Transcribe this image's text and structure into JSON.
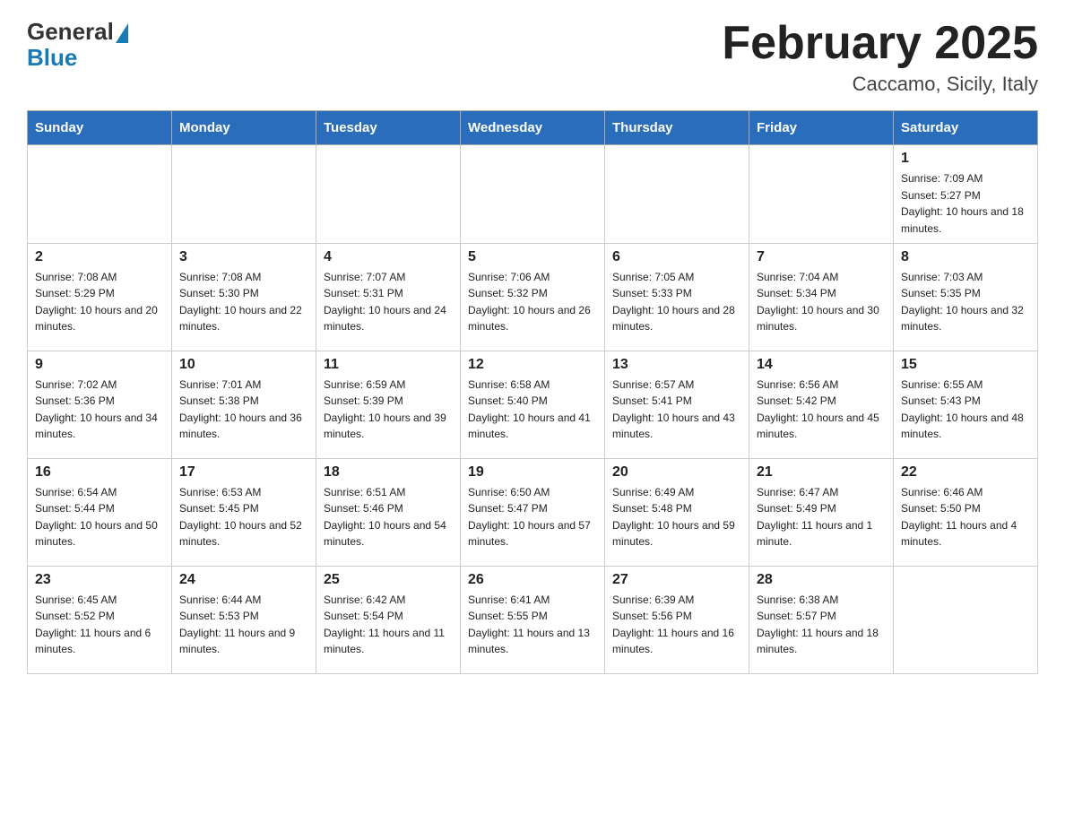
{
  "header": {
    "logo_general": "General",
    "logo_blue": "Blue",
    "month_title": "February 2025",
    "location": "Caccamo, Sicily, Italy"
  },
  "days_of_week": [
    "Sunday",
    "Monday",
    "Tuesday",
    "Wednesday",
    "Thursday",
    "Friday",
    "Saturday"
  ],
  "weeks": [
    [
      {
        "day": "",
        "info": ""
      },
      {
        "day": "",
        "info": ""
      },
      {
        "day": "",
        "info": ""
      },
      {
        "day": "",
        "info": ""
      },
      {
        "day": "",
        "info": ""
      },
      {
        "day": "",
        "info": ""
      },
      {
        "day": "1",
        "info": "Sunrise: 7:09 AM\nSunset: 5:27 PM\nDaylight: 10 hours and 18 minutes."
      }
    ],
    [
      {
        "day": "2",
        "info": "Sunrise: 7:08 AM\nSunset: 5:29 PM\nDaylight: 10 hours and 20 minutes."
      },
      {
        "day": "3",
        "info": "Sunrise: 7:08 AM\nSunset: 5:30 PM\nDaylight: 10 hours and 22 minutes."
      },
      {
        "day": "4",
        "info": "Sunrise: 7:07 AM\nSunset: 5:31 PM\nDaylight: 10 hours and 24 minutes."
      },
      {
        "day": "5",
        "info": "Sunrise: 7:06 AM\nSunset: 5:32 PM\nDaylight: 10 hours and 26 minutes."
      },
      {
        "day": "6",
        "info": "Sunrise: 7:05 AM\nSunset: 5:33 PM\nDaylight: 10 hours and 28 minutes."
      },
      {
        "day": "7",
        "info": "Sunrise: 7:04 AM\nSunset: 5:34 PM\nDaylight: 10 hours and 30 minutes."
      },
      {
        "day": "8",
        "info": "Sunrise: 7:03 AM\nSunset: 5:35 PM\nDaylight: 10 hours and 32 minutes."
      }
    ],
    [
      {
        "day": "9",
        "info": "Sunrise: 7:02 AM\nSunset: 5:36 PM\nDaylight: 10 hours and 34 minutes."
      },
      {
        "day": "10",
        "info": "Sunrise: 7:01 AM\nSunset: 5:38 PM\nDaylight: 10 hours and 36 minutes."
      },
      {
        "day": "11",
        "info": "Sunrise: 6:59 AM\nSunset: 5:39 PM\nDaylight: 10 hours and 39 minutes."
      },
      {
        "day": "12",
        "info": "Sunrise: 6:58 AM\nSunset: 5:40 PM\nDaylight: 10 hours and 41 minutes."
      },
      {
        "day": "13",
        "info": "Sunrise: 6:57 AM\nSunset: 5:41 PM\nDaylight: 10 hours and 43 minutes."
      },
      {
        "day": "14",
        "info": "Sunrise: 6:56 AM\nSunset: 5:42 PM\nDaylight: 10 hours and 45 minutes."
      },
      {
        "day": "15",
        "info": "Sunrise: 6:55 AM\nSunset: 5:43 PM\nDaylight: 10 hours and 48 minutes."
      }
    ],
    [
      {
        "day": "16",
        "info": "Sunrise: 6:54 AM\nSunset: 5:44 PM\nDaylight: 10 hours and 50 minutes."
      },
      {
        "day": "17",
        "info": "Sunrise: 6:53 AM\nSunset: 5:45 PM\nDaylight: 10 hours and 52 minutes."
      },
      {
        "day": "18",
        "info": "Sunrise: 6:51 AM\nSunset: 5:46 PM\nDaylight: 10 hours and 54 minutes."
      },
      {
        "day": "19",
        "info": "Sunrise: 6:50 AM\nSunset: 5:47 PM\nDaylight: 10 hours and 57 minutes."
      },
      {
        "day": "20",
        "info": "Sunrise: 6:49 AM\nSunset: 5:48 PM\nDaylight: 10 hours and 59 minutes."
      },
      {
        "day": "21",
        "info": "Sunrise: 6:47 AM\nSunset: 5:49 PM\nDaylight: 11 hours and 1 minute."
      },
      {
        "day": "22",
        "info": "Sunrise: 6:46 AM\nSunset: 5:50 PM\nDaylight: 11 hours and 4 minutes."
      }
    ],
    [
      {
        "day": "23",
        "info": "Sunrise: 6:45 AM\nSunset: 5:52 PM\nDaylight: 11 hours and 6 minutes."
      },
      {
        "day": "24",
        "info": "Sunrise: 6:44 AM\nSunset: 5:53 PM\nDaylight: 11 hours and 9 minutes."
      },
      {
        "day": "25",
        "info": "Sunrise: 6:42 AM\nSunset: 5:54 PM\nDaylight: 11 hours and 11 minutes."
      },
      {
        "day": "26",
        "info": "Sunrise: 6:41 AM\nSunset: 5:55 PM\nDaylight: 11 hours and 13 minutes."
      },
      {
        "day": "27",
        "info": "Sunrise: 6:39 AM\nSunset: 5:56 PM\nDaylight: 11 hours and 16 minutes."
      },
      {
        "day": "28",
        "info": "Sunrise: 6:38 AM\nSunset: 5:57 PM\nDaylight: 11 hours and 18 minutes."
      },
      {
        "day": "",
        "info": ""
      }
    ]
  ]
}
